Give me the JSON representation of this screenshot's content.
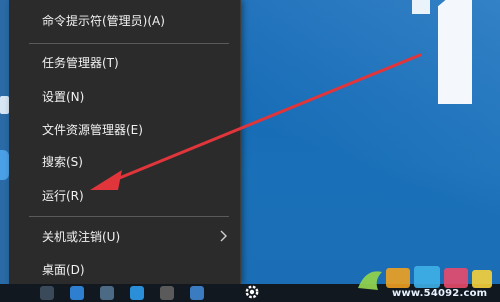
{
  "menu": {
    "items": [
      {
        "label": "命令提示符(管理员)(A)"
      },
      {
        "label": "任务管理器(T)"
      },
      {
        "label": "设置(N)"
      },
      {
        "label": "文件资源管理器(E)"
      },
      {
        "label": "搜索(S)"
      },
      {
        "label": "运行(R)"
      },
      {
        "label": "关机或注销(U)"
      },
      {
        "label": "桌面(D)"
      }
    ]
  },
  "watermark": {
    "site": "www.54092.com"
  },
  "colors": {
    "menu_bg": "#2b2b2b",
    "menu_text": "#f2f2f2",
    "desktop_blue": "#1a70b8",
    "arrow_red": "#e0353a"
  },
  "icons": [
    "chevron-right-icon",
    "gear-icon",
    "red-arrow-icon",
    "site-logo-icon"
  ]
}
